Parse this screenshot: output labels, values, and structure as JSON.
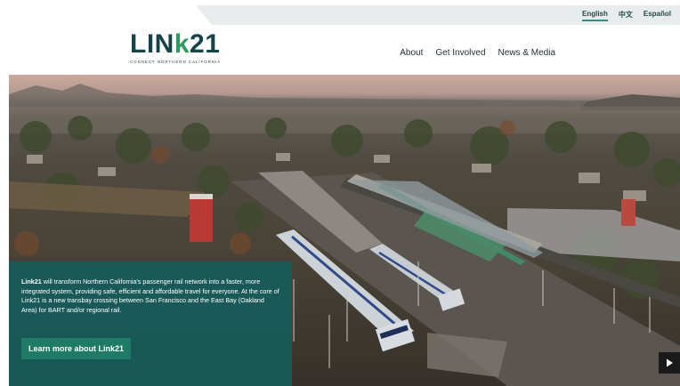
{
  "languages": [
    {
      "label": "English",
      "active": true
    },
    {
      "label": "中文",
      "active": false
    },
    {
      "label": "Español",
      "active": false
    }
  ],
  "logo": {
    "word_a": "LIN",
    "word_k": "k",
    "word_b": "21",
    "tagline": "CONNECT NORTHERN CALIFORNIA"
  },
  "nav": {
    "items": [
      {
        "label": "About"
      },
      {
        "label": "Get Involved"
      },
      {
        "label": "News & Media"
      }
    ]
  },
  "hero": {
    "intro_bold": "Link21",
    "intro_text": " will transform Northern California's passenger rail network into a faster, more integrated system, providing safe, efficient and affordable travel for everyone. At the core of Link21 is a new transbay crossing between San Francisco and the East Bay (Oakland Area) for BART and/or regional rail.",
    "cta_label": "Learn more about Link21",
    "play_icon": "play-icon"
  },
  "colors": {
    "brand_dark": "#16424a",
    "brand_green": "#2f9a5e",
    "panel": "#165c5c",
    "button": "#1f7a66"
  }
}
